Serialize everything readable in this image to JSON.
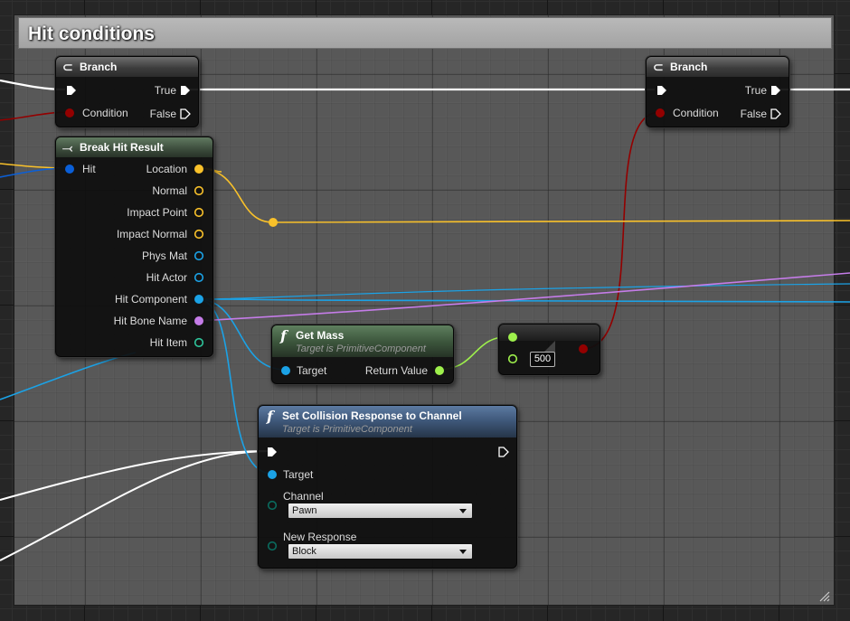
{
  "comment": {
    "title": "Hit conditions"
  },
  "branch_left": {
    "title": "Branch",
    "true_label": "True",
    "condition_label": "Condition",
    "false_label": "False"
  },
  "branch_right": {
    "title": "Branch",
    "true_label": "True",
    "condition_label": "Condition",
    "false_label": "False"
  },
  "break_hit": {
    "title": "Break Hit Result",
    "input_label": "Hit",
    "outputs": [
      "Location",
      "Normal",
      "Impact Point",
      "Impact Normal",
      "Phys Mat",
      "Hit Actor",
      "Hit Component",
      "Hit Bone Name",
      "Hit Item"
    ]
  },
  "get_mass": {
    "title": "Get Mass",
    "subtitle": "Target is PrimitiveComponent",
    "target_label": "Target",
    "return_label": "Return Value"
  },
  "compare": {
    "value": "500"
  },
  "set_collision": {
    "title": "Set Collision Response to Channel",
    "subtitle": "Target is PrimitiveComponent",
    "target_label": "Target",
    "channel_label": "Channel",
    "channel_value": "Pawn",
    "response_label": "New Response",
    "response_value": "Block"
  },
  "icons": [
    "branch-icon",
    "break-struct-icon",
    "function-icon",
    "exec-pin-icon"
  ],
  "colors": {
    "exec": "#ffffff",
    "bool": "#930000",
    "vector": "#f9c12a",
    "object": "#1ba2e6",
    "struct": "#0a5fd8",
    "name": "#c57ce8",
    "float": "#9ef04c",
    "item": "#2ec49b"
  }
}
